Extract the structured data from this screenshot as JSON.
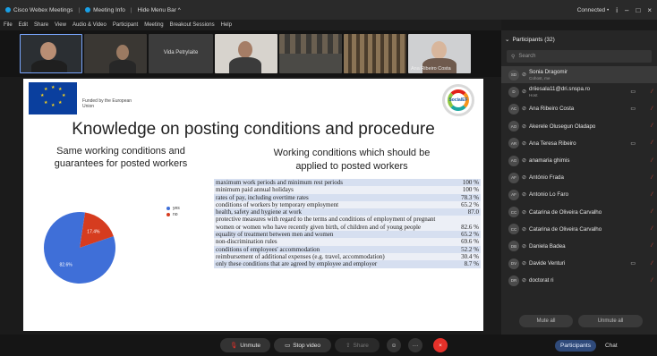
{
  "titlebar": {
    "app_name": "Cisco Webex Meetings",
    "meeting_info": "Meeting Info",
    "hide_menu": "Hide Menu Bar ^",
    "status": "Connected •",
    "win_info": "i",
    "win_min": "–",
    "win_restore": "□",
    "win_close": "×"
  },
  "menubar": [
    "File",
    "Edit",
    "Share",
    "View",
    "Audio & Video",
    "Participant",
    "Meeting",
    "Breakout Sessions",
    "Help"
  ],
  "video_strip": {
    "center_tile_name": "Vida Petrylaite",
    "last_tile_name": "Ana Ribeiro Costa"
  },
  "slide": {
    "funded_text": "Funded by the European Union",
    "logo_text": "SocialEF",
    "title": "Knowledge on posting conditions and procedure",
    "left_heading": "Same working conditions and guarantees for posted workers",
    "right_heading": "Working conditions which should be applied to posted workers",
    "pie_labels": {
      "yes": "82.6%",
      "no": "17.4%"
    },
    "legend": [
      {
        "label": "yes",
        "color": "#3f6fd8"
      },
      {
        "label": "no",
        "color": "#d63c1f"
      }
    ],
    "conditions": [
      {
        "text": "maximum work periods and minimum rest periods",
        "value": "100 %"
      },
      {
        "text": "minimum paid annual holidays",
        "value": "100 %"
      },
      {
        "text": "rates of pay, including overtime rates",
        "value": "78.3 %"
      },
      {
        "text": "conditions of workers by temporary employment",
        "value": "65.2 %"
      },
      {
        "text": "health, safety and hygiene at work",
        "value": "87.0"
      },
      {
        "text": "protective measures with regard to the terms and conditions of employment of pregnant women or women who have recently given birth, of children and of young people",
        "value": "82.6 %"
      },
      {
        "text": "equality of treatment between men and women",
        "value": "65.2 %"
      },
      {
        "text": "non-discrimination rules",
        "value": "69.6 %"
      },
      {
        "text": "conditions of employees' accommodation",
        "value": "52.2 %"
      },
      {
        "text": "reimbursement of additional expenses (e.g. travel, accommodation)",
        "value": "30.4 %"
      },
      {
        "text": "only these conditions that are agreed by employee and employer",
        "value": "8.7 %"
      }
    ]
  },
  "chart_data": {
    "type": "pie",
    "categories": [
      "yes",
      "no"
    ],
    "values": [
      82.6,
      17.4
    ],
    "title": "Same working conditions and guarantees for posted workers"
  },
  "controls": {
    "unmute": "Unmute",
    "stop_video": "Stop video",
    "share": "Share",
    "leave": "×"
  },
  "participants": {
    "header": "Participants (32)",
    "search_placeholder": "Search",
    "list": [
      {
        "initials": "SD",
        "name": "Sonia Dragomir",
        "role": "Cohost, me",
        "video": "",
        "muted": false,
        "highlight": true
      },
      {
        "initials": "D",
        "name": "driiesala11@dri.snspa.ro",
        "role": "Host",
        "video": "▭",
        "muted": true,
        "highlight": false
      },
      {
        "initials": "AC",
        "name": "Ana Ribeiro Costa",
        "role": "",
        "video": "▭",
        "muted": true,
        "highlight": false
      },
      {
        "initials": "AO",
        "name": "Akerele Olusegun Oladapo",
        "role": "",
        "video": "",
        "muted": true,
        "highlight": false
      },
      {
        "initials": "AR",
        "name": "Ana Teresa Ribeiro",
        "role": "",
        "video": "▭",
        "muted": true,
        "highlight": false
      },
      {
        "initials": "AG",
        "name": "anamaria ghimis",
        "role": "",
        "video": "",
        "muted": true,
        "highlight": false
      },
      {
        "initials": "AF",
        "name": "António Frada",
        "role": "",
        "video": "",
        "muted": true,
        "highlight": false
      },
      {
        "initials": "AF",
        "name": "Antonio Lo Faro",
        "role": "",
        "video": "",
        "muted": true,
        "highlight": false
      },
      {
        "initials": "CC",
        "name": "Catarina de Oliveira Carvalho",
        "role": "",
        "video": "",
        "muted": true,
        "highlight": false
      },
      {
        "initials": "CC",
        "name": "Catarina de Oliveira Carvalho",
        "role": "",
        "video": "",
        "muted": true,
        "highlight": false
      },
      {
        "initials": "DB",
        "name": "Daniela Badea",
        "role": "",
        "video": "",
        "muted": true,
        "highlight": false
      },
      {
        "initials": "DV",
        "name": "Davide Venturi",
        "role": "",
        "video": "▭",
        "muted": true,
        "highlight": false
      },
      {
        "initials": "DR",
        "name": "doctorat ri",
        "role": "",
        "video": "",
        "muted": true,
        "highlight": false
      }
    ],
    "mute_all": "Mute all",
    "unmute_all": "Unmute all"
  },
  "bottom_right": {
    "participants": "Participants",
    "chat": "Chat"
  }
}
